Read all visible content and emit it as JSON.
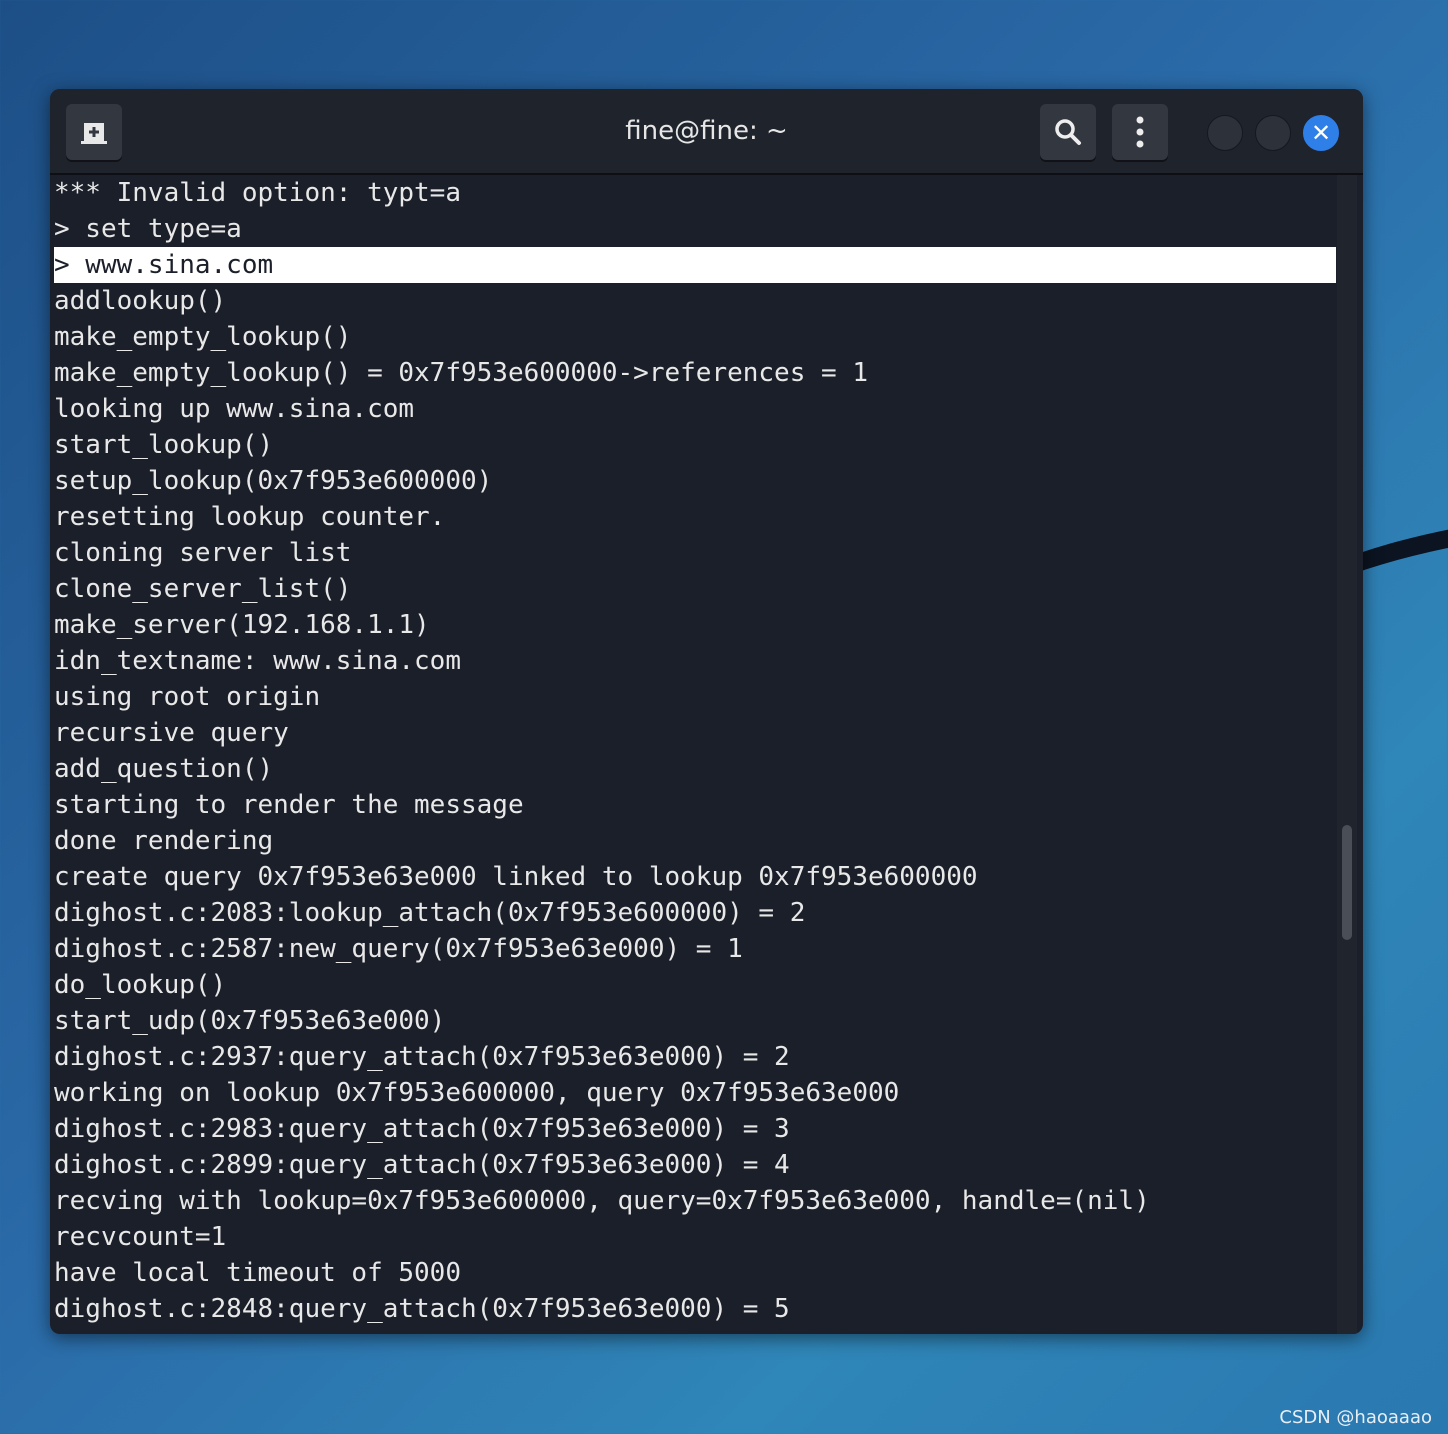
{
  "window": {
    "title": "fine@fine: ~"
  },
  "icons": {
    "new_tab": "new-tab-icon",
    "search": "search-icon",
    "menu": "kebab-menu-icon",
    "close": "close-icon"
  },
  "colors": {
    "close_button": "#2f7fe8",
    "terminal_bg": "#1b1f29",
    "highlight": "#ffffff"
  },
  "terminal": {
    "highlighted_line": 2,
    "lines": [
      "*** Invalid option: typt=a",
      "> set type=a",
      "> www.sina.com",
      "addlookup()",
      "make_empty_lookup()",
      "make_empty_lookup() = 0x7f953e600000->references = 1",
      "looking up www.sina.com",
      "start_lookup()",
      "setup_lookup(0x7f953e600000)",
      "resetting lookup counter.",
      "cloning server list",
      "clone_server_list()",
      "make_server(192.168.1.1)",
      "idn_textname: www.sina.com",
      "using root origin",
      "recursive query",
      "add_question()",
      "starting to render the message",
      "done rendering",
      "create query 0x7f953e63e000 linked to lookup 0x7f953e600000",
      "dighost.c:2083:lookup_attach(0x7f953e600000) = 2",
      "dighost.c:2587:new_query(0x7f953e63e000) = 1",
      "do_lookup()",
      "start_udp(0x7f953e63e000)",
      "dighost.c:2937:query_attach(0x7f953e63e000) = 2",
      "working on lookup 0x7f953e600000, query 0x7f953e63e000",
      "dighost.c:2983:query_attach(0x7f953e63e000) = 3",
      "dighost.c:2899:query_attach(0x7f953e63e000) = 4",
      "recving with lookup=0x7f953e600000, query=0x7f953e63e000, handle=(nil)",
      "recvcount=1",
      "have local timeout of 5000",
      "dighost.c:2848:query_attach(0x7f953e63e000) = 5"
    ]
  },
  "watermark": "CSDN @haoaaao"
}
